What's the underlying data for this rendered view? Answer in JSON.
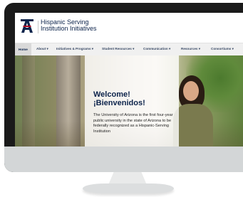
{
  "site": {
    "title_line1": "Hispanic Serving",
    "title_line2": "Institution Initiatives"
  },
  "nav": {
    "items": [
      {
        "label": "Home"
      },
      {
        "label": "About ▾"
      },
      {
        "label": "Initiatives & Programs ▾"
      },
      {
        "label": "Student Resources ▾"
      },
      {
        "label": "Communication ▾"
      },
      {
        "label": "Resources ▾"
      },
      {
        "label": "Consortiums ▾"
      }
    ]
  },
  "hero": {
    "welcome_en": "Welcome!",
    "welcome_es": "¡Bienvenidos!",
    "body": "The University of Arizona is the first four-year public university in the state of Arizona to be federally recognized as a Hispanic-Serving Institution"
  },
  "colors": {
    "brand_navy": "#0c234b",
    "brand_red": "#ab0520"
  }
}
